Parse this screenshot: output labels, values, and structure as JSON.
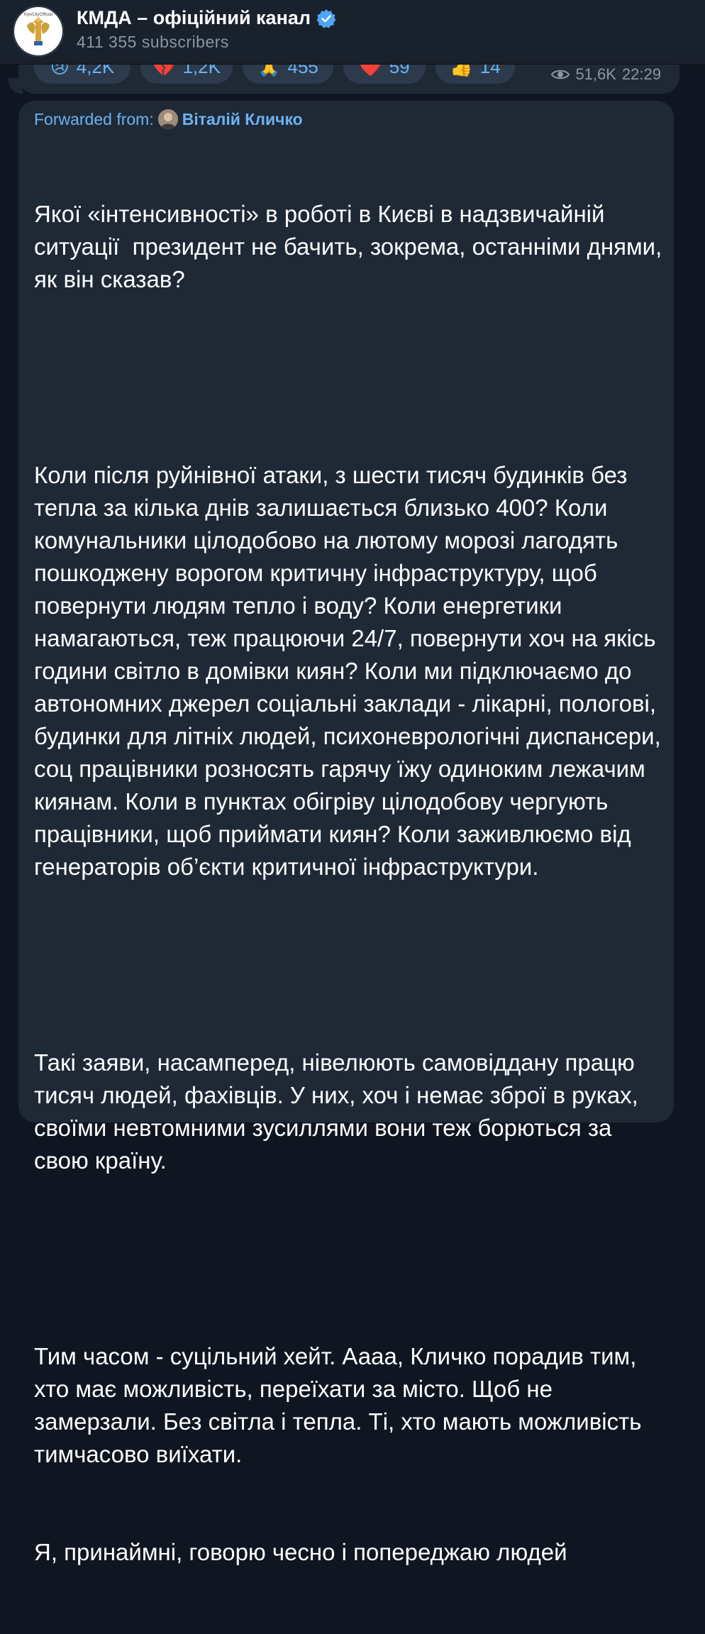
{
  "header": {
    "channel_title": "КМДА – офіційний канал",
    "subscribers": "411 355 subscribers",
    "avatar_caption": "KyivCityOfficial"
  },
  "previous_message": {
    "reactions": [
      {
        "emoji": "😢",
        "count": "4,2K"
      },
      {
        "emoji": "💔",
        "count": "1,2K"
      },
      {
        "emoji": "🙏",
        "count": "455"
      },
      {
        "emoji": "❤️",
        "count": "59"
      },
      {
        "emoji": "👍",
        "count": "14"
      }
    ],
    "views": "51,6K",
    "time": "22:29"
  },
  "message": {
    "forwarded_label": "Forwarded from:",
    "forwarded_name": "Віталій Кличко",
    "paragraphs": [
      "Якої «інтенсивності» в роботі в Києві в надзвичайній ситуації  президент не бачить, зокрема, останніми днями, як він сказав?",
      "Коли після руйнівної атаки, з шести тисяч будинків без тепла за кілька днів залишається близько 400? Коли комунальники цілодобово на лютому морозі лагодять пошкоджену ворогом критичну інфраструктуру, щоб повернути людям тепло і воду? Коли енергетики намагаються, теж працюючи 24/7, повернути хоч на якісь години світло в домівки киян? Коли ми підключаємо до автономних джерел соціальні заклади - лікарні, пологові, будинки для літніх людей, психоневрологічні диспансери, соц працівники розносять гарячу їжу одиноким лежачим киянам. Коли в пунктах обігріву цілодобову чергують працівники, щоб приймати киян? Коли заживлюємо від генераторів об’єкти критичної інфраструктури.",
      "Такі заяви, насамперед, нівелюють самовіддану працю тисяч людей, фахівців. У них, хоч і немає зброї в руках, своїми невтомними зусиллями вони теж борються за свою країну.",
      "Тим часом - суцільний хейт. Аааа, Кличко порадив тим, хто має можливість, переїхати за місто. Щоб не замерзали. Без світла і тепла. Ті, хто мають можливість тимчасово виїхати.",
      "Я, принаймні, говорю чесно і попереджаю людей"
    ]
  },
  "colors": {
    "background": "#0f1621",
    "bubble": "#1f2936",
    "accent": "#6ab3f3",
    "muted": "#8b96a3",
    "verified": "#4ea4f6"
  }
}
